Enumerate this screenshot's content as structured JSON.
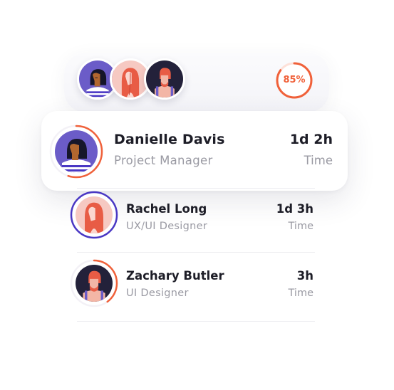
{
  "header": {
    "team_avatars": [
      {
        "name": "Danielle Davis",
        "icon": "avatar-woman-dark-hair"
      },
      {
        "name": "Rachel Long",
        "icon": "avatar-woman-red-hair"
      },
      {
        "name": "Zachary Butler",
        "icon": "avatar-man-red-hair"
      }
    ],
    "progress": {
      "label": "85%",
      "value": 0.85
    }
  },
  "featured": {
    "name": "Danielle Davis",
    "role": "Project Manager",
    "time": "1d 2h",
    "time_label": "Time",
    "ring_progress": 0.55
  },
  "list": [
    {
      "name": "Rachel Long",
      "role": "UX/UI Designer",
      "time": "1d 3h",
      "time_label": "Time",
      "ring_progress": 1.0,
      "ring_color": "#4a38c4"
    },
    {
      "name": "Zachary Butler",
      "role": "UI Designer",
      "time": "3h",
      "time_label": "Time",
      "ring_progress": 0.4,
      "ring_color": "#f0613a"
    }
  ],
  "colors": {
    "accent": "#f0613a",
    "violet": "#4a38c4",
    "text_primary": "#1d1d27",
    "text_secondary": "#9a9aa3"
  }
}
